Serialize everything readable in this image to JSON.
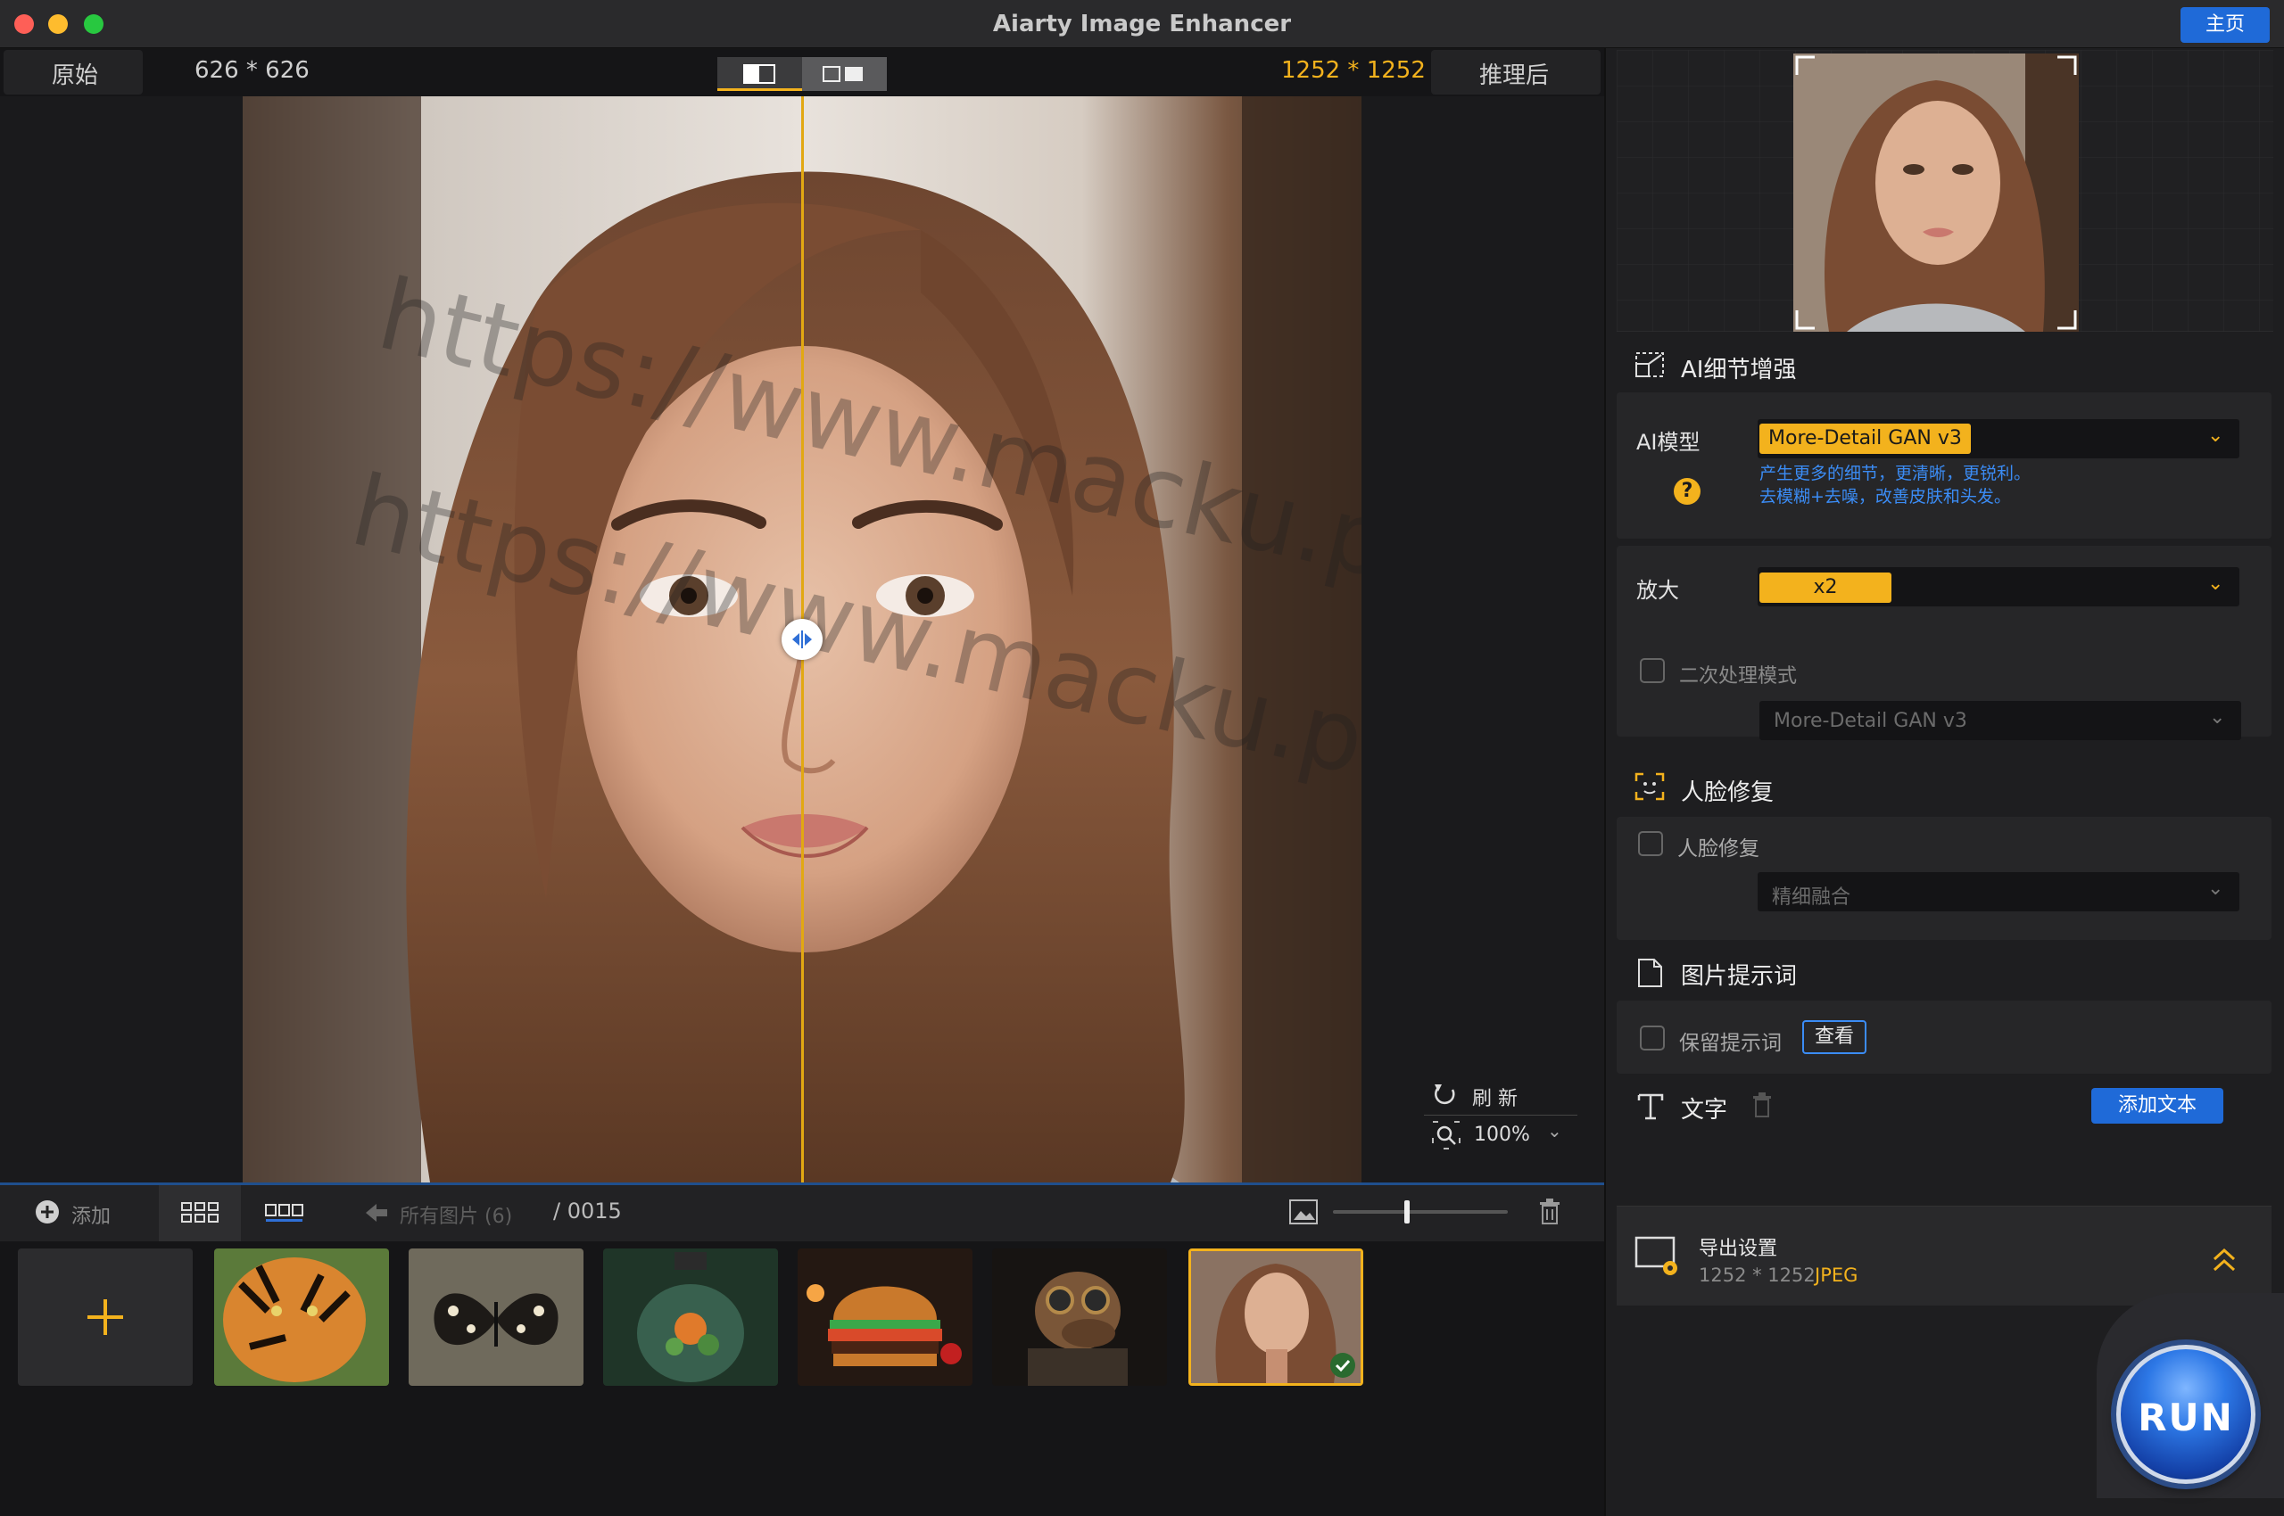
{
  "window": {
    "title": "Aiarty Image Enhancer",
    "home_label": "主页"
  },
  "topbar": {
    "original_label": "原始",
    "original_size": "626 * 626",
    "result_size": "1252 * 1252",
    "result_label": "推理后"
  },
  "canvas": {
    "watermark_1": "https://www.macku.pro/",
    "watermark_2": "https://www.macku.pro/",
    "refresh_label": "刷  新",
    "zoom_label": "100%"
  },
  "bottombar": {
    "add_label": "添加",
    "all_images_label": "所有图片 (6)",
    "counter": "/ 0015"
  },
  "right_panel": {
    "detail_section": "AI细节增强",
    "ai_model_label": "AI模型",
    "ai_model_value": "More-Detail GAN v3",
    "ai_model_note_1": "产生更多的细节，更清晰，更锐利。",
    "ai_model_note_2": "去模糊+去噪，改善皮肤和头发。",
    "upscale_label": "放大",
    "upscale_value": "x2",
    "secondary_mode_label": "二次处理模式",
    "secondary_model_value": "More-Detail GAN v3",
    "face_section": "人脸修复",
    "face_checkbox_label": "人脸修复",
    "face_mode_value": "精细融合",
    "prompt_section": "图片提示词",
    "keep_prompt_label": "保留提示词",
    "view_button": "查看",
    "text_section": "文字",
    "add_text_button": "添加文本",
    "export_title": "导出设置",
    "export_size": "1252 * 1252",
    "export_format": "JPEG",
    "run_label": "RUN"
  },
  "colors": {
    "accent": "#f3b21d",
    "brand_blue": "#1f6ad8",
    "note_blue": "#3b8cf5"
  }
}
